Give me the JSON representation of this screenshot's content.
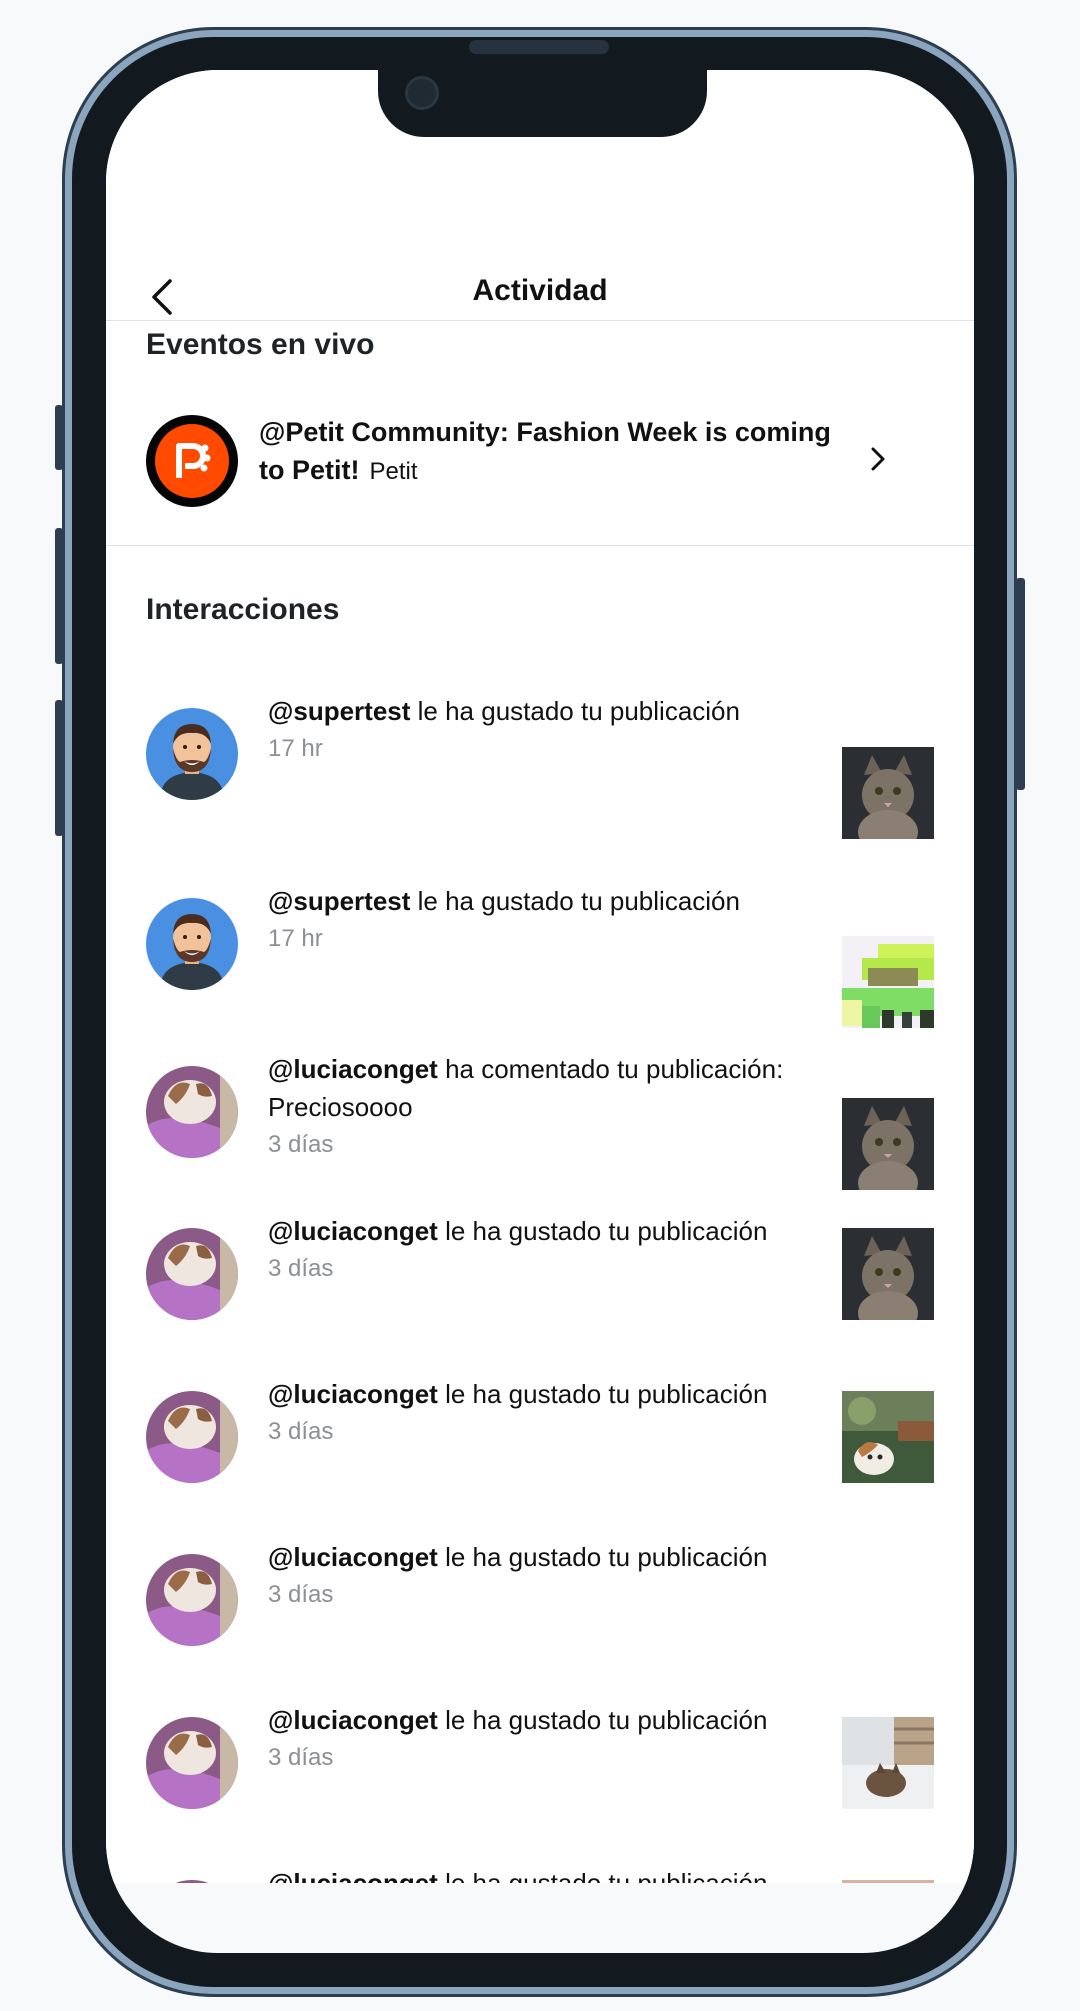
{
  "header": {
    "title": "Actividad"
  },
  "live_events": {
    "section_title": "Eventos en vivo",
    "event": {
      "title": "@Petit Community: Fashion Week is coming to Petit!",
      "source": "Petit"
    }
  },
  "interactions": {
    "section_title": "Interacciones",
    "items": [
      {
        "user": "@supertest",
        "action": "le ha gustado tu publicación",
        "time": "17 hr"
      },
      {
        "user": "@supertest",
        "action": "le ha gustado tu publicación",
        "time": "17 hr"
      },
      {
        "user": "@luciaconget",
        "action": "ha comentado tu publicación: Preciosoooo",
        "time": "3 días"
      },
      {
        "user": "@luciaconget",
        "action": "le ha gustado tu publicación",
        "time": "3 días"
      },
      {
        "user": "@luciaconget",
        "action": "le ha gustado tu publicación",
        "time": "3 días"
      },
      {
        "user": "@luciaconget",
        "action": "le ha gustado tu publicación",
        "time": "3 días"
      },
      {
        "user": "@luciaconget",
        "action": "le ha gustado tu publicación",
        "time": "3 días"
      },
      {
        "user": "@luciaconget",
        "action": "le ha gustado tu publicación",
        "time": ""
      }
    ]
  },
  "colors": {
    "brand": "#ff4a00",
    "frame": "#8aa5bd",
    "muted_text": "#8c8f93"
  }
}
